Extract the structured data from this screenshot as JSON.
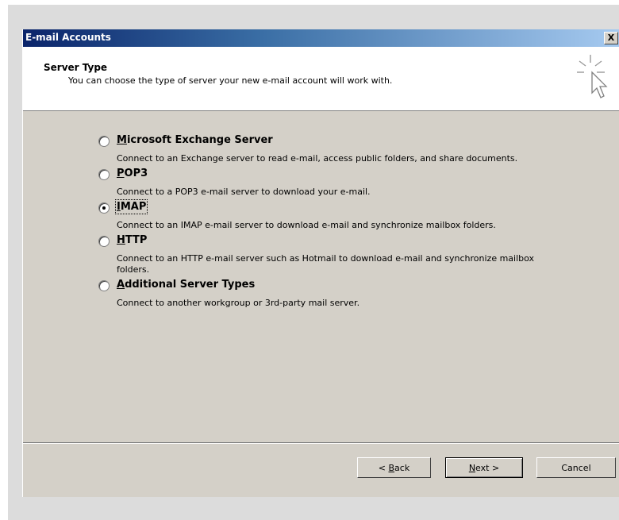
{
  "window": {
    "title": "E-mail Accounts",
    "close_glyph": "X"
  },
  "header": {
    "title": "Server Type",
    "subtitle": "You can choose the type of server your new e-mail account will work with.",
    "icon": "wizard-cursor-icon"
  },
  "options": [
    {
      "mnemonic": "M",
      "rest": "icrosoft Exchange Server",
      "checked": false,
      "description": "Connect to an Exchange server to read e-mail, access public folders, and share documents."
    },
    {
      "mnemonic": "P",
      "rest": "OP3",
      "checked": false,
      "description": "Connect to a POP3 e-mail server to download your e-mail."
    },
    {
      "mnemonic": "I",
      "rest": "MAP",
      "checked": true,
      "description": "Connect to an IMAP e-mail server to download e-mail and synchronize mailbox folders."
    },
    {
      "mnemonic": "H",
      "rest": "TTP",
      "checked": false,
      "description": "Connect to an HTTP e-mail server such as Hotmail to download e-mail and synchronize mailbox folders."
    },
    {
      "mnemonic": "A",
      "rest": "dditional Server Types",
      "checked": false,
      "description": "Connect to another workgroup or 3rd-party mail server."
    }
  ],
  "buttons": {
    "back_prefix": "< ",
    "back_mnemonic": "B",
    "back_rest": "ack",
    "next_mnemonic": "N",
    "next_rest": "ext >",
    "cancel": "Cancel"
  }
}
